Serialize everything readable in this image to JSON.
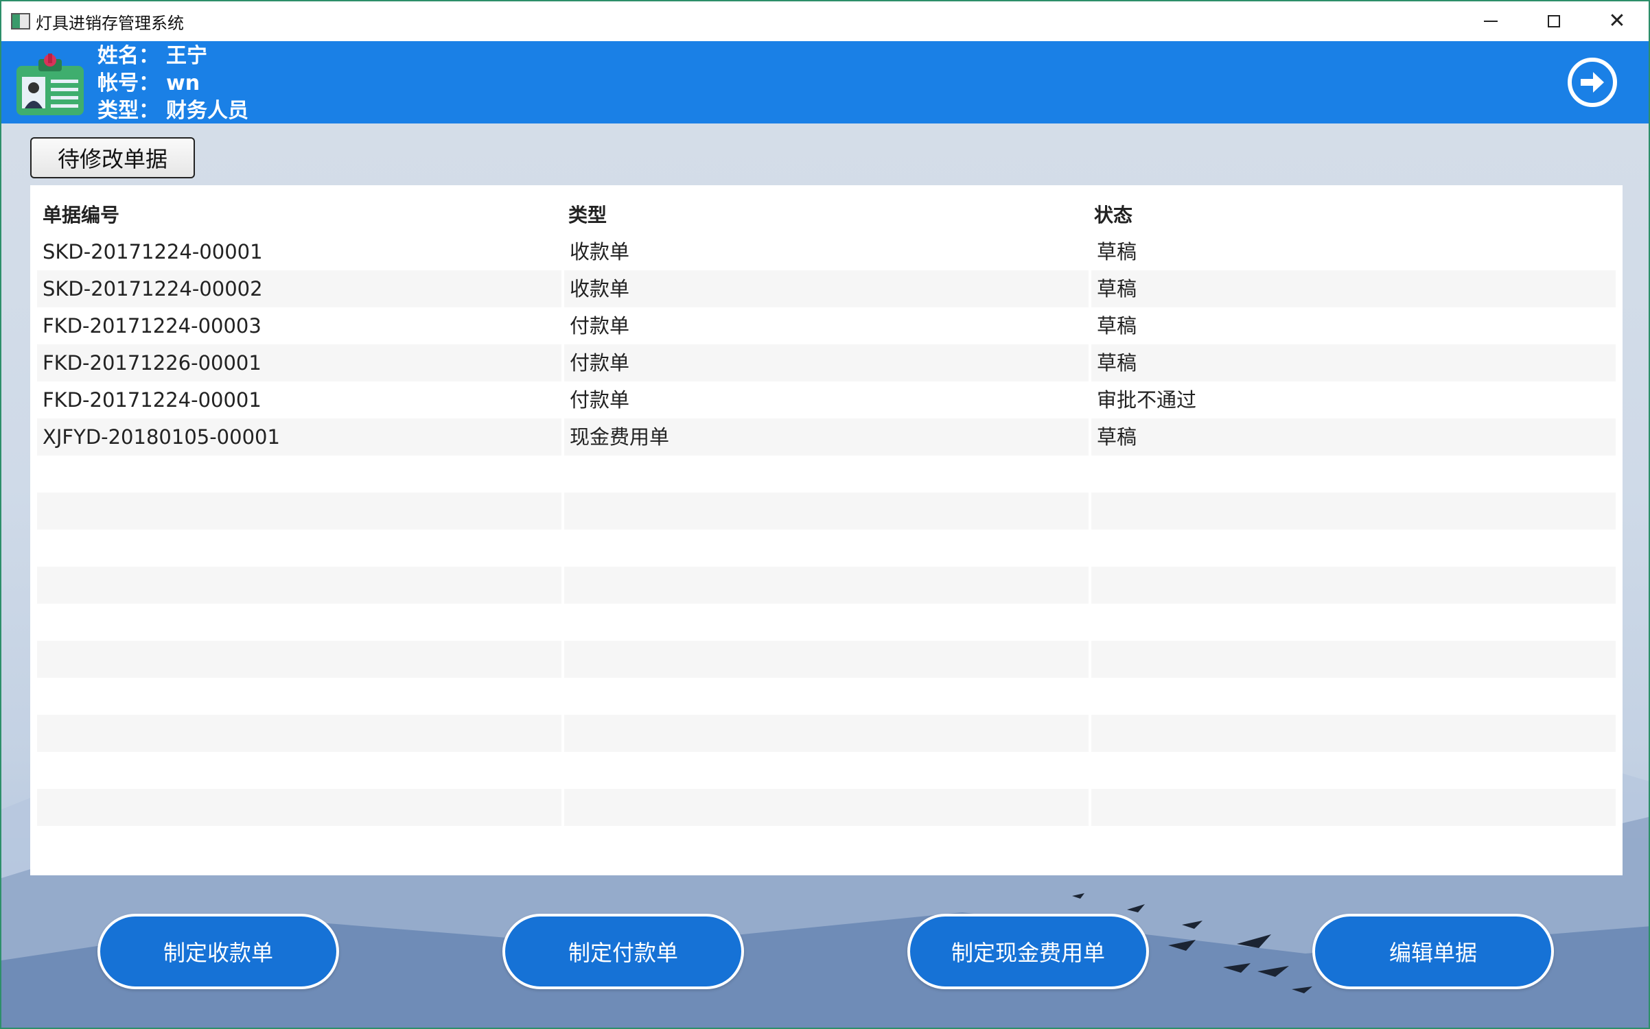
{
  "window": {
    "title": "灯具进销存管理系统"
  },
  "user": {
    "name_label": "姓名：",
    "name_value": "王宁",
    "account_label": "帐号：",
    "account_value": "wn",
    "type_label": "类型：",
    "type_value": "财务人员"
  },
  "tabs": {
    "pending_label": "待修改单据"
  },
  "table": {
    "headers": [
      "单据编号",
      "类型",
      "状态"
    ],
    "rows": [
      [
        "SKD-20171224-00001",
        "收款单",
        "草稿"
      ],
      [
        "SKD-20171224-00002",
        "收款单",
        "草稿"
      ],
      [
        "FKD-20171224-00003",
        "付款单",
        "草稿"
      ],
      [
        "FKD-20171226-00001",
        "付款单",
        "草稿"
      ],
      [
        "FKD-20171224-00001",
        "付款单",
        "审批不通过"
      ],
      [
        "XJFYD-20180105-00001",
        "现金费用单",
        "草稿"
      ]
    ]
  },
  "actions": {
    "receipt_label": "制定收款单",
    "payment_label": "制定付款单",
    "cash_expense_label": "制定现金费用单",
    "edit_label": "编辑单据"
  },
  "icons": {
    "app": "app-icon",
    "avatar": "id-card-icon",
    "exit": "arrow-right-circle-icon",
    "minimize": "minimize-icon",
    "maximize": "maximize-icon",
    "close": "close-icon"
  },
  "colors": {
    "header_bg": "#1a80e6",
    "button_bg": "#1672d6",
    "window_border": "#2d8f6a"
  }
}
